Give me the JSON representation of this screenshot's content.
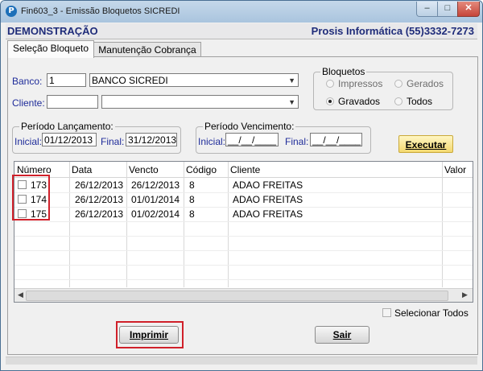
{
  "window": {
    "title": "Fin603_3 - Emissão Bloquetos SICREDI",
    "app_icon": "P",
    "minimize": "–",
    "maximize": "□",
    "close": "✕"
  },
  "header": {
    "mode": "DEMONSTRAÇÃO",
    "company": "Prosis Informática (55)3332-7273"
  },
  "tabs": [
    {
      "label": "Seleção Bloqueto"
    },
    {
      "label": "Manutenção Cobrança"
    }
  ],
  "banco": {
    "label": "Banco:",
    "code": "1",
    "name": "BANCO SICREDI"
  },
  "cliente": {
    "label": "Cliente:",
    "code": "",
    "name": ""
  },
  "bloquetos": {
    "title": "Bloquetos",
    "options": [
      {
        "label": "Impressos",
        "checked": false
      },
      {
        "label": "Gerados",
        "checked": false
      },
      {
        "label": "Gravados",
        "checked": true
      },
      {
        "label": "Todos",
        "checked": false
      }
    ]
  },
  "periodo_lancamento": {
    "title": "Período Lançamento:",
    "inicial_label": "Inicial:",
    "inicial": "01/12/2013",
    "final_label": "Final:",
    "final": "31/12/2013"
  },
  "periodo_vencimento": {
    "title": "Período Vencimento:",
    "inicial_label": "Inicial:",
    "inicial": "__/__/____",
    "final_label": "Final:",
    "final": "__/__/____"
  },
  "executar_label": "Executar",
  "table": {
    "columns": [
      "Número",
      "Data",
      "Vencto",
      "Código",
      "Cliente",
      "Valor"
    ],
    "rows": [
      {
        "numero": "173",
        "data": "26/12/2013",
        "vencto": "26/12/2013",
        "codigo": "8",
        "cliente": "ADAO FREITAS"
      },
      {
        "numero": "174",
        "data": "26/12/2013",
        "vencto": "01/01/2014",
        "codigo": "8",
        "cliente": "ADAO FREITAS"
      },
      {
        "numero": "175",
        "data": "26/12/2013",
        "vencto": "01/02/2014",
        "codigo": "8",
        "cliente": "ADAO FREITAS"
      }
    ]
  },
  "selecionar_todos": "Selecionar Todos",
  "imprimir_label": "Imprimir",
  "sair_label": "Sair",
  "colors": {
    "title_blue": "#1f2c7a",
    "label_blue": "#1f2c9a",
    "highlight_red": "#d0202a",
    "exec_yellow": "#f3d870"
  }
}
